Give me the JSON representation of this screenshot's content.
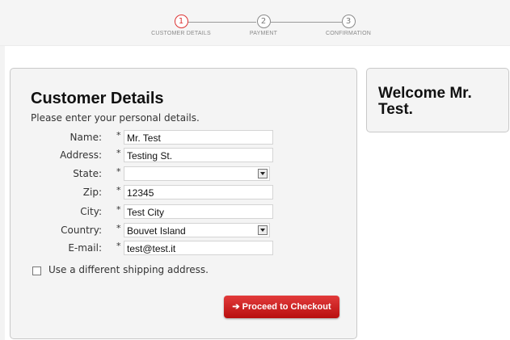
{
  "steps": [
    {
      "number": "1",
      "label": "CUSTOMER DETAILS",
      "active": true
    },
    {
      "number": "2",
      "label": "PAYMENT",
      "active": false
    },
    {
      "number": "3",
      "label": "CONFIRMATION",
      "active": false
    }
  ],
  "form": {
    "title": "Customer Details",
    "subtitle": "Please enter your personal details.",
    "required_mark": "*",
    "fields": {
      "name": {
        "label": "Name:",
        "value": "Mr. Test"
      },
      "address": {
        "label": "Address:",
        "value": "Testing St."
      },
      "state": {
        "label": "State:",
        "value": ""
      },
      "zip": {
        "label": "Zip:",
        "value": "12345"
      },
      "city": {
        "label": "City:",
        "value": "Test City"
      },
      "country": {
        "label": "Country:",
        "value": "Bouvet Island"
      },
      "email": {
        "label": "E-mail:",
        "value": "test@test.it"
      }
    },
    "shipping_checkbox_label": "Use a different shipping address.",
    "shipping_checked": false,
    "checkout_button": "➔ Proceed to Checkout"
  },
  "welcome": {
    "text": "Welcome Mr. Test."
  },
  "colors": {
    "accent": "#c9191b",
    "active_step": "#dd3333",
    "panel_bg": "#f4f4f4"
  },
  "icons": {
    "select_arrow": "chevron-down-icon",
    "checkout_arrow": "arrow-right-icon"
  }
}
